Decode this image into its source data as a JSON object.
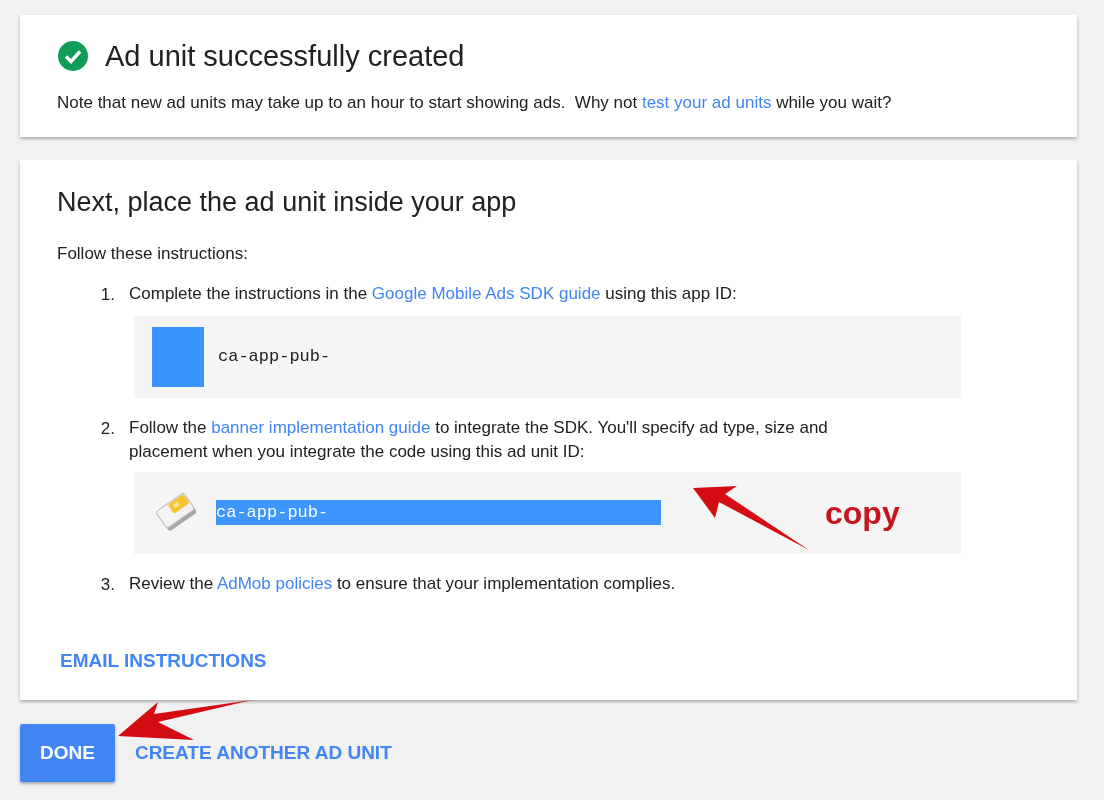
{
  "success_card": {
    "title": "Ad unit successfully created",
    "note_before": "Note that new ad units may take up to an hour to start showing ads.  Why not ",
    "note_link": "test your ad units",
    "note_after": " while you wait?"
  },
  "instructions_card": {
    "title": "Next, place the ad unit inside your app",
    "intro": "Follow these instructions:",
    "steps": [
      {
        "number": "1.",
        "before": "Complete the instructions in the ",
        "link": "Google Mobile Ads SDK guide",
        "after": " using this app ID:",
        "code": {
          "kind": "masked",
          "value": "ca-app-pub-",
          "selected": false
        }
      },
      {
        "number": "2.",
        "before": "Follow the ",
        "link": "banner implementation guide",
        "after": " to integrate the SDK. You'll specify ad type, size and placement when you integrate the code using this ad unit ID:",
        "code": {
          "kind": "copy",
          "value": "ca-app-pub-",
          "selected": true
        }
      },
      {
        "number": "3.",
        "before": "Review the ",
        "link": "AdMob policies",
        "after": " to ensure that your implementation complies."
      }
    ],
    "email_button": "EMAIL INSTRUCTIONS"
  },
  "annotation": {
    "label": "copy"
  },
  "buttons": [
    {
      "label": "DONE",
      "primary": true
    },
    {
      "label": "CREATE ANOTHER AD UNIT",
      "primary": false
    }
  ]
}
